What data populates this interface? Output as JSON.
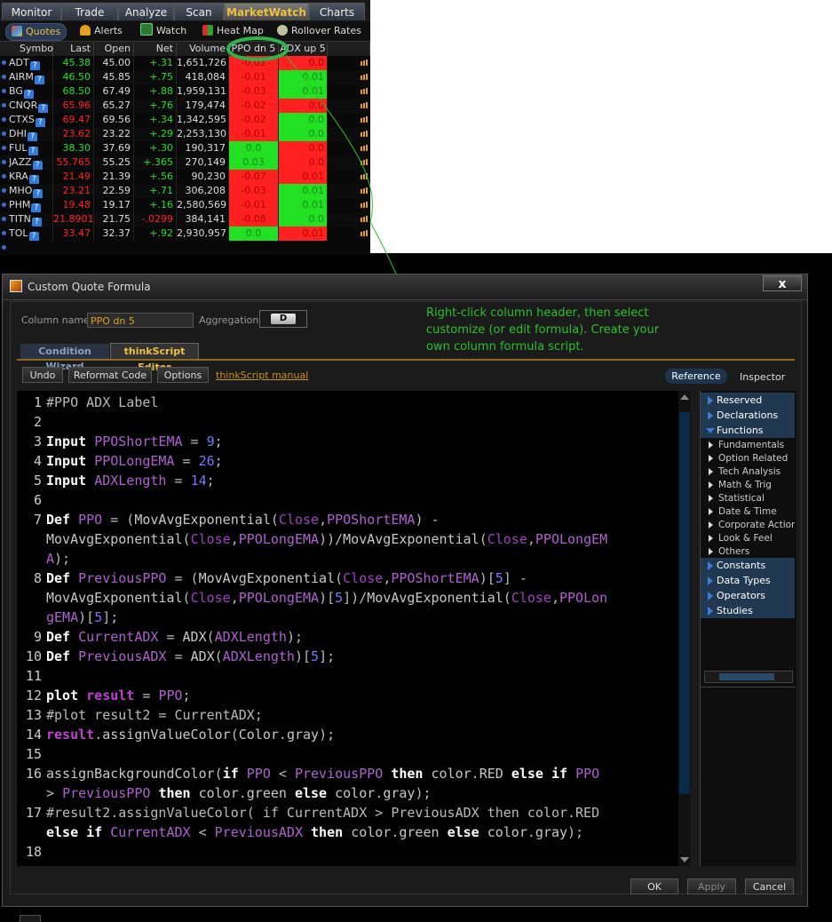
{
  "top_tabs": [
    "Monitor",
    "Trade",
    "Analyze",
    "Scan",
    "MarketWatch",
    "Charts"
  ],
  "sub_tabs": [
    "Quotes",
    "Alerts",
    "Watch",
    "Heat Map",
    "Rollover Rates"
  ],
  "table": {
    "headers": [
      "Symbol",
      "Last",
      "Open",
      "Net Ch...",
      "Volume",
      "PPO dn 5",
      "ADX up 5"
    ],
    "rows": [
      {
        "symbol": "ADT",
        "last": "45.38",
        "open": "45.00",
        "net": "+.31",
        "volume": "1,651,726",
        "ppo": "-0.02",
        "ppo_color": "red",
        "adx": "0.0",
        "adx_color": "red",
        "last_color": "green"
      },
      {
        "symbol": "AIRM",
        "last": "46.50",
        "open": "45.85",
        "net": "+.75",
        "volume": "418,084",
        "ppo": "-0.01",
        "ppo_color": "red",
        "adx": "0.01",
        "adx_color": "green",
        "last_color": "green"
      },
      {
        "symbol": "BG",
        "last": "68.50",
        "open": "67.49",
        "net": "+.88",
        "volume": "1,959,131",
        "ppo": "-0.03",
        "ppo_color": "red",
        "adx": "0.01",
        "adx_color": "green",
        "last_color": "green"
      },
      {
        "symbol": "CNQR",
        "last": "65.96",
        "open": "65.27",
        "net": "+.76",
        "volume": "179,474",
        "ppo": "-0.02",
        "ppo_color": "red",
        "adx": "0.0",
        "adx_color": "red",
        "last_color": "red"
      },
      {
        "symbol": "CTXS",
        "last": "69.47",
        "open": "69.56",
        "net": "+.34",
        "volume": "1,342,595",
        "ppo": "-0.02",
        "ppo_color": "red",
        "adx": "0.0",
        "adx_color": "green",
        "last_color": "red"
      },
      {
        "symbol": "DHI",
        "last": "23.62",
        "open": "23.22",
        "net": "+.29",
        "volume": "2,253,130",
        "ppo": "-0.01",
        "ppo_color": "red",
        "adx": "0.0",
        "adx_color": "green",
        "last_color": "red"
      },
      {
        "symbol": "FUL",
        "last": "38.30",
        "open": "37.69",
        "net": "+.30",
        "volume": "190,317",
        "ppo": "0.0",
        "ppo_color": "green",
        "adx": "0.0",
        "adx_color": "red",
        "last_color": "green"
      },
      {
        "symbol": "JAZZ",
        "last": "55.765",
        "open": "55.25",
        "net": "+.365",
        "volume": "270,149",
        "ppo": "0.03",
        "ppo_color": "green",
        "adx": "0.0",
        "adx_color": "red",
        "last_color": "red"
      },
      {
        "symbol": "KRA",
        "last": "21.49",
        "open": "21.39",
        "net": "+.56",
        "volume": "90,230",
        "ppo": "-0.07",
        "ppo_color": "red",
        "adx": "0.01",
        "adx_color": "red",
        "last_color": "red"
      },
      {
        "symbol": "MHO",
        "last": "23.21",
        "open": "22.59",
        "net": "+.71",
        "volume": "306,208",
        "ppo": "-0.03",
        "ppo_color": "red",
        "adx": "0.01",
        "adx_color": "green",
        "last_color": "red"
      },
      {
        "symbol": "PHM",
        "last": "19.48",
        "open": "19.17",
        "net": "+.16",
        "volume": "2,580,569",
        "ppo": "-0.01",
        "ppo_color": "red",
        "adx": "0.01",
        "adx_color": "green",
        "last_color": "red"
      },
      {
        "symbol": "TITN",
        "last": "21.8901",
        "open": "21.75",
        "net": "-.0299",
        "volume": "384,141",
        "ppo": "-0.08",
        "ppo_color": "red",
        "adx": "0.0",
        "adx_color": "green",
        "last_color": "red"
      },
      {
        "symbol": "TOL",
        "last": "33.47",
        "open": "32.37",
        "net": "+.92",
        "volume": "2,930,957",
        "ppo": "0.0",
        "ppo_color": "green",
        "adx": "0.01",
        "adx_color": "red",
        "last_color": "red"
      }
    ]
  },
  "dialog": {
    "title": "Custom Quote Formula",
    "close": "x",
    "column_name_label": "Column name:",
    "column_name_value": "PPO dn 5",
    "aggregation_label": "Aggregation:",
    "aggregation_value": "D",
    "tabs": [
      "Condition Wizard",
      "thinkScript Editor"
    ],
    "toolbar": {
      "undo": "Undo",
      "reformat": "Reformat Code",
      "options": "Options",
      "manual": "thinkScript manual"
    },
    "right_tabs": [
      "Reference",
      "Inspector"
    ],
    "reference": [
      "Reserved Words",
      "Declarations",
      "Functions"
    ],
    "functions": [
      "Fundamentals",
      "Option Related",
      "Tech Analysis",
      "Math & Trig",
      "Statistical",
      "Date & Time",
      "Corporate Action",
      "Look & Feel",
      "Others"
    ],
    "reference2": [
      "Constants",
      "Data Types",
      "Operators",
      "Studies"
    ],
    "buttons": {
      "ok": "OK",
      "apply": "Apply",
      "cancel": "Cancel"
    }
  },
  "code_lines": [
    {
      "n": "1",
      "t": "#PPO ADX Label"
    },
    {
      "n": "2",
      "t": ""
    },
    {
      "n": "3",
      "t": "Input PPOShortEMA = 9;"
    },
    {
      "n": "4",
      "t": "Input PPOLongEMA = 26;"
    },
    {
      "n": "5",
      "t": "Input ADXLength = 14;"
    },
    {
      "n": "6",
      "t": ""
    },
    {
      "n": "7",
      "t": "Def PPO = (MovAvgExponential(Close,PPOShortEMA) -"
    },
    {
      "n": "",
      "t": "MovAvgExponential(Close,PPOLongEMA))/MovAvgExponential(Close,PPOLongEM"
    },
    {
      "n": "",
      "t": "A);"
    },
    {
      "n": "8",
      "t": "Def PreviousPPO = (MovAvgExponential(Close,PPOShortEMA)[5] -"
    },
    {
      "n": "",
      "t": "MovAvgExponential(Close,PPOLongEMA)[5])/MovAvgExponential(Close,PPOLon"
    },
    {
      "n": "",
      "t": "gEMA)[5];"
    },
    {
      "n": "9",
      "t": "Def CurrentADX = ADX(ADXLength);"
    },
    {
      "n": "10",
      "t": "Def PreviousADX = ADX(ADXLength)[5];"
    },
    {
      "n": "11",
      "t": ""
    },
    {
      "n": "12",
      "t": "plot result = PPO;"
    },
    {
      "n": "13",
      "t": "#plot result2 = CurrentADX;"
    },
    {
      "n": "14",
      "t": "result.assignValueColor(Color.gray);"
    },
    {
      "n": "15",
      "t": ""
    },
    {
      "n": "16",
      "t": "assignBackgroundColor(if PPO < PreviousPPO then color.RED else if PPO"
    },
    {
      "n": "",
      "t": "> PreviousPPO then color.green else color.gray);"
    },
    {
      "n": "17",
      "t": "#result2.assignValueColor( if CurrentADX > PreviousADX then color.RED"
    },
    {
      "n": "",
      "t": "else if CurrentADX < PreviousADX then color.green else color.gray);"
    },
    {
      "n": "18",
      "t": ""
    }
  ],
  "annotation": "Right-click column header, then select customize (or edit formula). Create your own column formula script.",
  "colors": {
    "red": "#ff2020",
    "green": "#22e022",
    "accent": "#f0c040",
    "annot": "#2cc02c"
  }
}
